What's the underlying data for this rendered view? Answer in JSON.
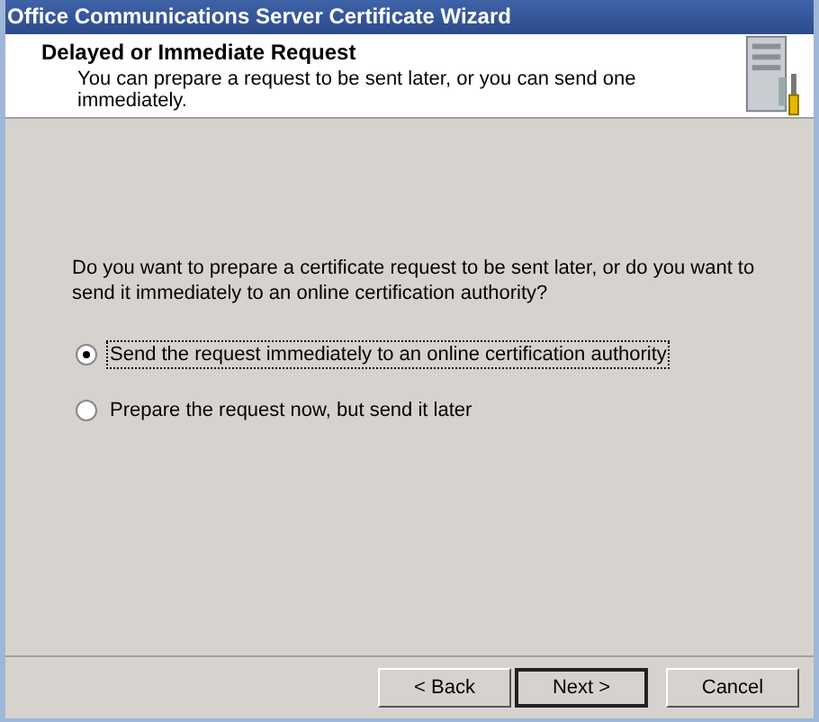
{
  "window": {
    "title": "Office Communications Server Certificate Wizard"
  },
  "header": {
    "title": "Delayed or Immediate Request",
    "subtitle": "You can prepare a request to be sent later, or you can send one immediately."
  },
  "question": "Do you want to prepare a certificate request to be sent later, or do you want to send it immediately to an online certification authority?",
  "options": [
    {
      "label": "Send the request immediately to an online certification authority",
      "selected": true
    },
    {
      "label": "Prepare the request now, but send it later",
      "selected": false
    }
  ],
  "buttons": [
    {
      "label": "< Back",
      "default": false
    },
    {
      "label": "Next >",
      "default": true
    },
    {
      "label": "Cancel",
      "default": false
    }
  ]
}
